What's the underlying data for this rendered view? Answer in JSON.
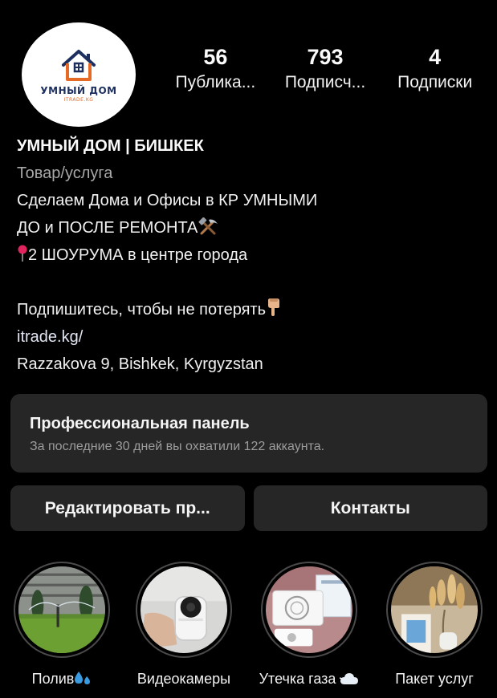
{
  "profile": {
    "avatar": {
      "brand_name": "УМНЫЙ ДОМ",
      "brand_sub": "ITRADE.KG"
    },
    "stats": [
      {
        "value": "56",
        "label": "Публика..."
      },
      {
        "value": "793",
        "label": "Подписч..."
      },
      {
        "value": "4",
        "label": "Подписки"
      }
    ]
  },
  "bio": {
    "name": "УМНЫЙ ДОМ | БИШКЕК",
    "category": "Товар/услуга",
    "line1": "Сделаем Дома и Офисы в КР УМНЫМИ",
    "line2": "ДО и ПОСЛЕ РЕМОНТА",
    "line3": "2 ШОУРУМА в центре города",
    "line4": "Подпишитесь, чтобы не потерять",
    "link": "itrade.kg/",
    "address": "Razzakova 9, Bishkek, Kyrgyzstan"
  },
  "pro_panel": {
    "title": "Профессиональная панель",
    "subtitle": "За последние 30 дней вы охватили 122 аккаунта."
  },
  "actions": {
    "edit_label": "Редактировать пр...",
    "contacts_label": "Контакты"
  },
  "highlights": [
    {
      "label": "Полив",
      "icon": "droplets-icon"
    },
    {
      "label": "Видеокамеры"
    },
    {
      "label": "Утечка газа",
      "icon": "cloud-icon"
    },
    {
      "label": "Пакет услуг"
    }
  ],
  "colors": {
    "background": "#000000",
    "panel": "#262626",
    "text": "#f5f5f5",
    "muted": "#a8a8a8",
    "brand_navy": "#1d2f5e",
    "brand_orange": "#e46a25"
  }
}
